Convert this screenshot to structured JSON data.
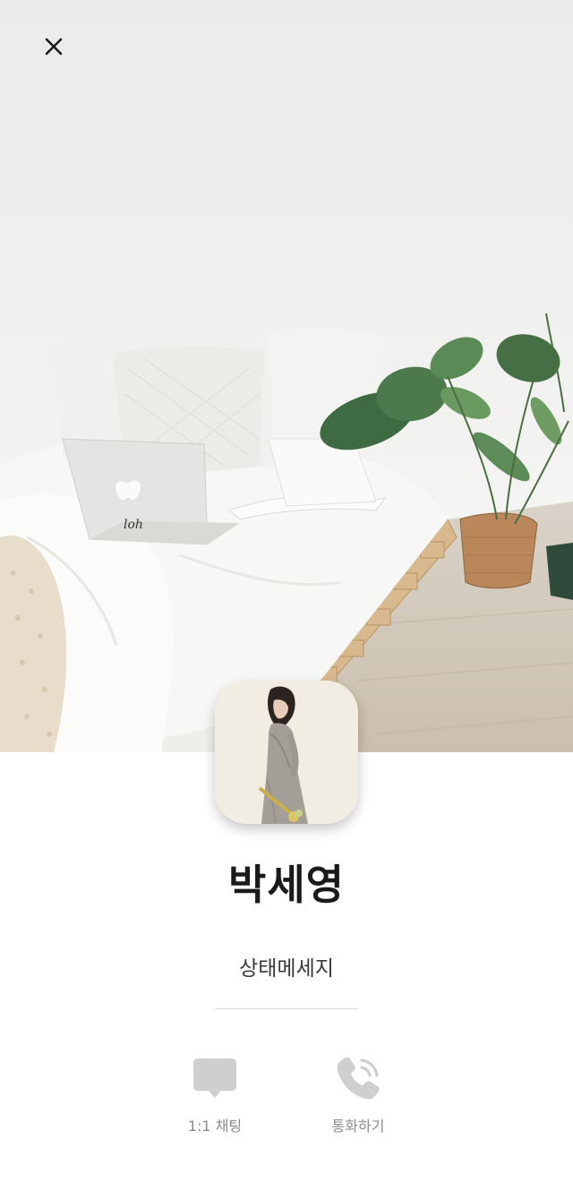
{
  "header": {
    "close_icon": "close-icon"
  },
  "cover": {
    "description_icon": "cover-photo"
  },
  "profile": {
    "name": "박세영",
    "status_message": "상태메세지"
  },
  "actions": {
    "chat_label": "1:1 채팅",
    "chat_icon": "chat-bubble-icon",
    "call_label": "통화하기",
    "call_icon": "phone-call-icon"
  },
  "colors": {
    "icon_gray": "#cfcfcf",
    "label_gray": "#8c8c8c",
    "name_text": "#1a1a1a"
  }
}
